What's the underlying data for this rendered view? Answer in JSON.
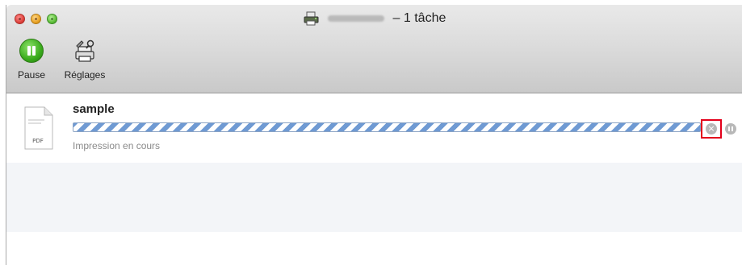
{
  "window": {
    "title_suffix": "– 1 tâche"
  },
  "toolbar": {
    "pause_label": "Pause",
    "settings_label": "Réglages"
  },
  "job": {
    "name": "sample",
    "file_type": "PDF",
    "status": "Impression en cours",
    "progress_state": "indeterminate"
  },
  "icons": {
    "close": "close-traffic-light",
    "minimize": "minimize-traffic-light",
    "zoom": "zoom-traffic-light",
    "printer": "printer-icon",
    "pause": "pause-icon",
    "settings": "settings-icon",
    "document": "pdf-document-icon",
    "cancel": "cancel-job-icon",
    "pause_job": "pause-job-icon"
  },
  "colors": {
    "highlight_border": "#e3001b",
    "progress_stripe": "#6f9ad3",
    "pause_green": "#3aab1c"
  }
}
